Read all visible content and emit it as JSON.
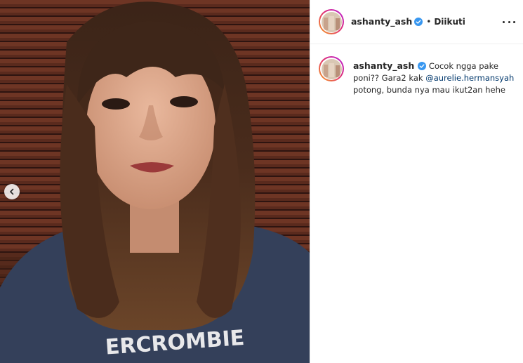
{
  "post": {
    "author": {
      "username": "ashanty_ash",
      "verified": true,
      "avatar_icon": "profile-photo"
    },
    "follow_status": "Diikuti",
    "separator": "•",
    "more_icon": "more-options-icon",
    "carousel": {
      "prev_icon": "chevron-left-icon"
    },
    "caption": {
      "username": "ashanty_ash",
      "text_part1": "Cocok ngga pake poni?? Gara2 kak",
      "mention": "@aurelie.hermansyah",
      "text_part2": "potong, bunda nya mau ikut2an hehe"
    },
    "colors": {
      "verified_blue": "#3897f0",
      "mention_blue": "#00376b",
      "text": "#262626",
      "border": "#efefef"
    }
  }
}
